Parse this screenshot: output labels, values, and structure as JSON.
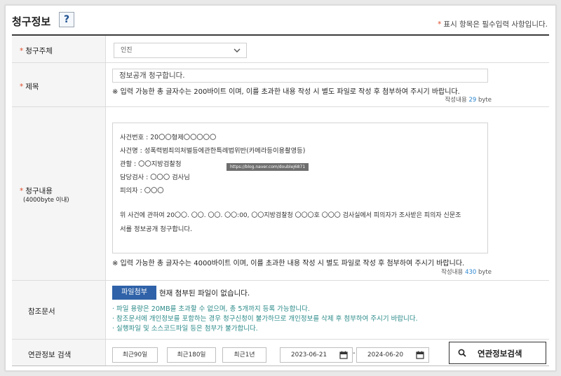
{
  "header": {
    "title": "청구정보",
    "help_symbol": "?",
    "required_star": "*",
    "required_note": "표시 항목은 필수입력 사항입니다."
  },
  "fields": {
    "claimant": {
      "label": "청구주체",
      "selected": "인진"
    },
    "subject": {
      "label": "제목",
      "value": "정보공개 청구합니다.",
      "notice": "※ 입력 가능한 총 글자수는 200바이트 이며, 이를 초과한 내용 작성 시 별도 파일로 작성 후 첨부하여 주시기 바랍니다.",
      "count_prefix": "작성내용",
      "count_value": "29",
      "count_unit": "byte"
    },
    "content": {
      "label": "청구내용",
      "sublabel": "(4000byte 이내)",
      "lines": [
        "사건번호 : 20〇〇형제〇〇〇〇〇",
        "사건명 : 성폭력범죄의처벌등에관한특례법위반(카메라등이용촬영등)",
        "관할 : 〇〇지방검찰청",
        "담당검사 : 〇〇〇 검사님",
        "피의자 : 〇〇〇",
        "위 사건에 관하여 20〇〇. 〇〇. 〇〇. 〇〇:00, 〇〇지방검찰청 〇〇〇호 〇〇〇 검사실에서 피의자가 조사받은 피의자 신문조",
        "서를 정보공개 청구합니다."
      ],
      "watermark": "https://blog.naver.com/doublej6871",
      "notice": "※ 입력 가능한 총 글자수는 4000바이트 이며, 이를 초과한 내용 작성 시 별도 파일로 작성 후 첨부하여 주시기 바랍니다.",
      "count_prefix": "작성내용",
      "count_value": "430",
      "count_unit": "byte"
    },
    "reference": {
      "label": "참조문서",
      "attach_label": "파일첨부",
      "no_file": "현재 첨부된 파일이 없습니다.",
      "bullets": [
        "· 파일 용량은 20MB를 초과할 수 없으며, 총 5개까지 등록 가능합니다.",
        "· 참조문서에 개인정보를 포함하는 경우 청구신청이 불가하므로 개인정보를 삭제 후 첨부하여 주시기 바랍니다.",
        "· 실행파일 및 소스코드파일 등은 첨부가 불가합니다."
      ]
    },
    "related": {
      "label": "연관정보 검색",
      "period_buttons": [
        "최근90일",
        "최근180일",
        "최근1년"
      ],
      "date_from": "2023-06-21",
      "date_sep": "-",
      "date_to": "2024-06-20",
      "search_label": "연관정보검색"
    }
  },
  "colors": {
    "required_star": "#e04b2a",
    "attach_button": "#2f62a8",
    "count_number": "#2b86d1",
    "bullet_text": "#2a8a88"
  },
  "icons": [
    "help-icon",
    "chevron-down-icon",
    "calendar-icon",
    "magnifier-icon"
  ]
}
